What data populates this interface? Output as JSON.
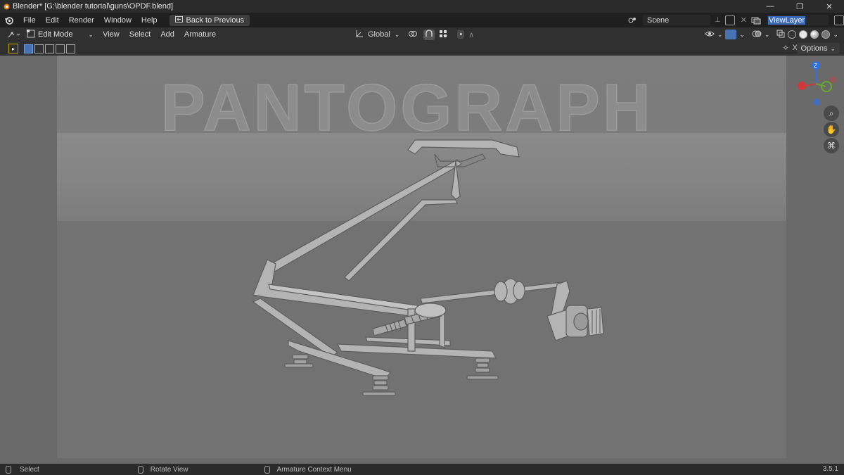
{
  "window": {
    "title": "Blender* [G:\\blender tutorial\\guns\\OPDF.blend]",
    "controls": {
      "minimize": "—",
      "maximize": "❐",
      "close": "✕"
    }
  },
  "menubar": {
    "items": [
      "File",
      "Edit",
      "Render",
      "Window",
      "Help"
    ],
    "back_button": "Back to Previous",
    "scene": "Scene",
    "view_layer": "ViewLayer"
  },
  "header": {
    "mode": "Edit Mode",
    "menus": [
      "View",
      "Select",
      "Add",
      "Armature"
    ],
    "orientation": "Global"
  },
  "toolbar": {
    "options_label": "Options",
    "xray_label": "X"
  },
  "viewport": {
    "overlay_text": "PANTOGRAPH",
    "gizmo_z_label": "Z"
  },
  "statusbar": {
    "select": "Select",
    "rotate": "Rotate View",
    "context": "Armature Context Menu",
    "version": "3.5.1"
  },
  "colors": {
    "accent": "#4772b3",
    "axis_x": "#d4373a",
    "axis_y": "#6aa62c",
    "axis_z": "#2f6fe0"
  }
}
